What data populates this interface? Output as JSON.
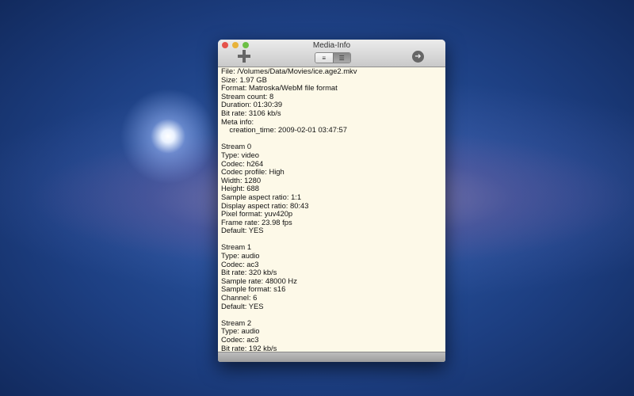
{
  "window": {
    "title": "Media-Info"
  },
  "toolbar": {
    "add_icon": "plus-icon",
    "view_left": "≡",
    "view_right": "☰",
    "go_icon": "➜"
  },
  "info_lines": [
    "File: /Volumes/Data/Movies/ice.age2.mkv",
    "Size: 1.97 GB",
    "Format: Matroska/WebM file format",
    "Stream count: 8",
    "Duration: 01:30:39",
    "Bit rate: 3106 kb/s",
    "Meta info:",
    "    creation_time: 2009-02-01 03:47:57",
    "",
    "Stream 0",
    "Type: video",
    "Codec: h264",
    "Codec profile: High",
    "Width: 1280",
    "Height: 688",
    "Sample aspect ratio: 1:1",
    "Display aspect ratio: 80:43",
    "Pixel format: yuv420p",
    "Frame rate: 23.98 fps",
    "Default: YES",
    "",
    "Stream 1",
    "Type: audio",
    "Codec: ac3",
    "Bit rate: 320 kb/s",
    "Sample rate: 48000 Hz",
    "Sample format: s16",
    "Channel: 6",
    "Default: YES",
    "",
    "Stream 2",
    "Type: audio",
    "Codec: ac3",
    "Bit rate: 192 kb/s"
  ]
}
